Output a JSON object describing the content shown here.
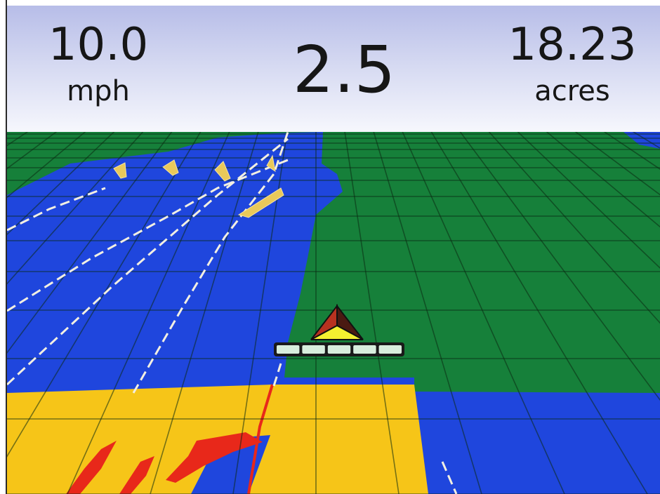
{
  "header": {
    "speed": {
      "value": "10.0",
      "unit": "mph"
    },
    "center_value": "2.5",
    "area": {
      "value": "18.23",
      "unit": "acres"
    }
  },
  "map": {
    "colors": {
      "covered": "#1f46dd",
      "uncovered": "#16803a",
      "current_pass": "#f6c518",
      "overlap": "#e8281a",
      "guidance_line": "#f2efe2",
      "grid_line": "#0b2a12",
      "vehicle_top": "#4a1a12",
      "vehicle_left": "#b83220",
      "vehicle_bottom": "#f4f030"
    },
    "vehicle": {
      "icon": "tractor-arrow-icon"
    },
    "implement": {
      "icon": "boom-sections-icon",
      "sections": 5
    }
  }
}
